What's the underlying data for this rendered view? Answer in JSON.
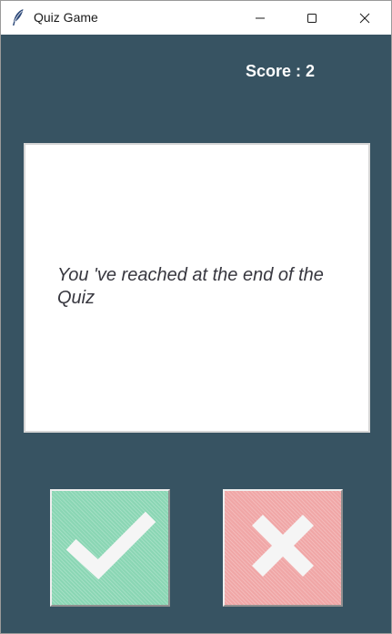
{
  "window": {
    "title": "Quiz Game",
    "icon": "feather-icon",
    "controls": [
      "minimize-icon",
      "maximize-icon",
      "close-icon"
    ]
  },
  "header": {
    "score_label": "Score : 2"
  },
  "question": {
    "text": "You 've reached at the end of the Quiz"
  },
  "buttons": {
    "true_icon": "checkmark-icon",
    "false_icon": "cross-icon"
  },
  "colors": {
    "background": "#375362",
    "true_button": "#8ad6b4",
    "false_button": "#f0a6a6",
    "card": "#ffffff"
  }
}
